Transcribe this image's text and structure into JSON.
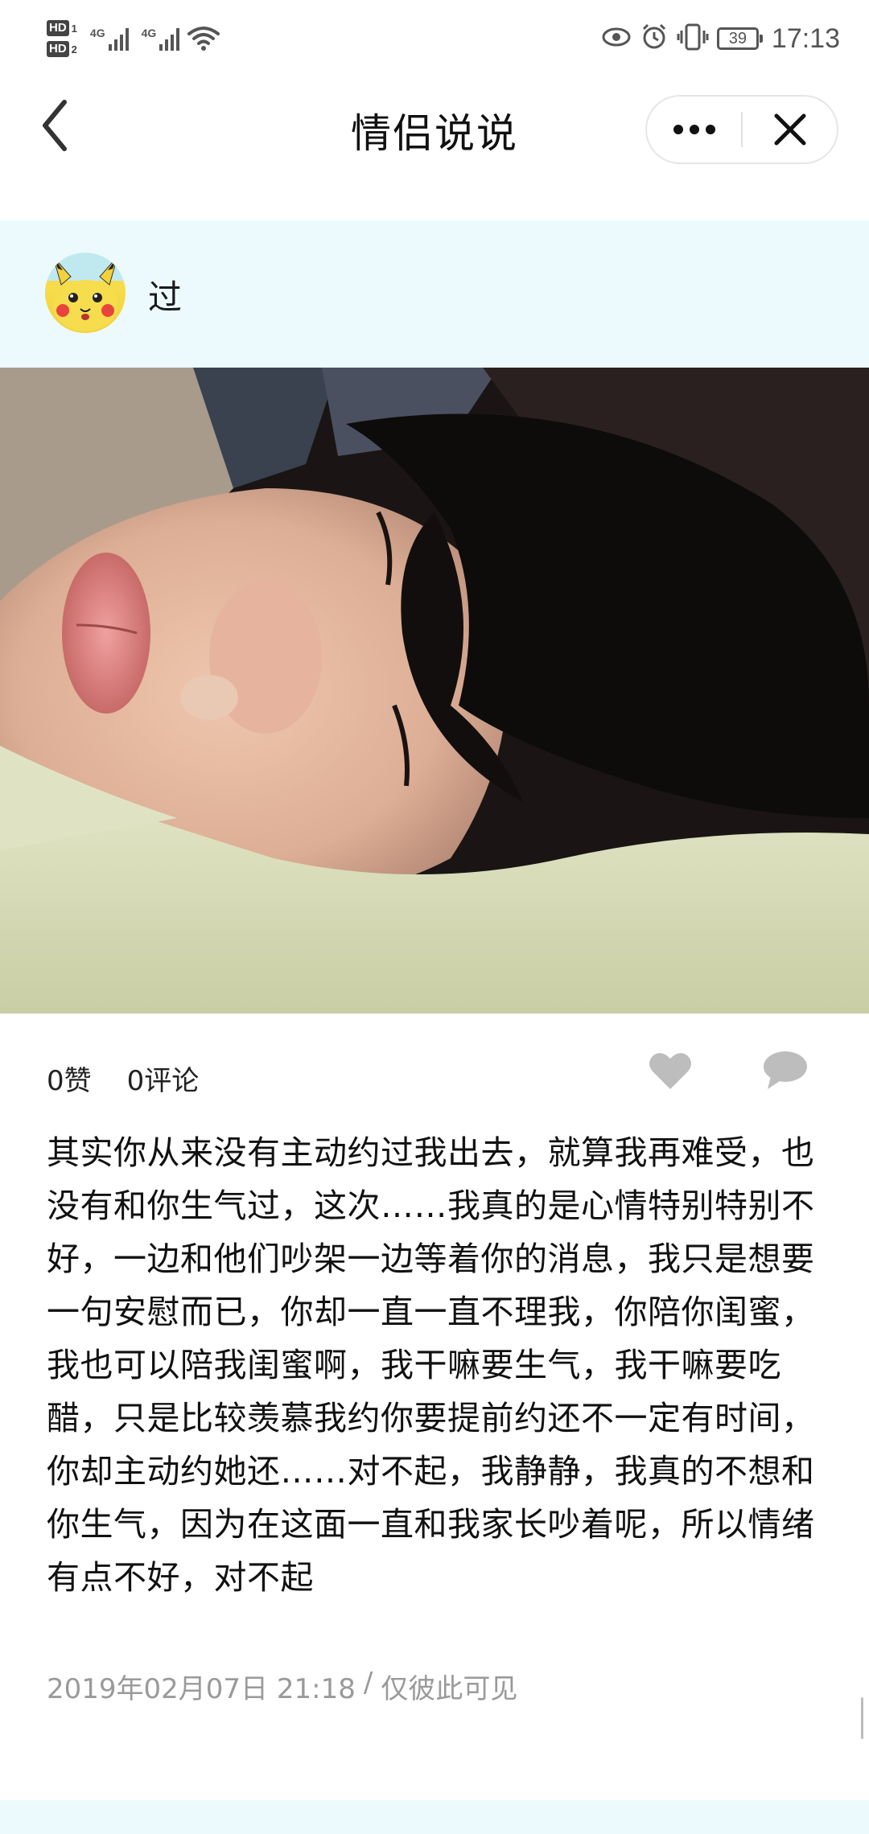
{
  "status_bar": {
    "sim1_badge": "HD",
    "sim1_num": "1",
    "sim2_badge": "HD",
    "sim2_num": "2",
    "network1": "4G",
    "network2": "4G",
    "battery": "39",
    "time": "17:13"
  },
  "title_bar": {
    "title": "情侣说说",
    "more_label": "•••",
    "close_label": "✕"
  },
  "post": {
    "username": "过",
    "likes": "0赞",
    "comments": "0评论",
    "text": "其实你从来没有主动约过我出去，就算我再难受，也没有和你生气过，这次……我真的是心情特别特别不好，一边和他们吵架一边等着你的消息，我只是想要一句安慰而已，你却一直一直不理我，你陪你闺蜜，我也可以陪我闺蜜啊，我干嘛要生气，我干嘛要吃醋，只是比较羡慕我约你要提前约还不一定有时间，你却主动约她还……对不起，我静静，我真的不想和你生气，因为在这面一直和我家长吵着呢，所以情绪有点不好，对不起",
    "timestamp": "2019年02月07日 21:18",
    "separator": "/",
    "visibility": "仅彼此可见"
  },
  "colors": {
    "header_bg": "#ecfafd",
    "icon_gray": "#bdbdbd",
    "meta_text": "#9a9a9a"
  }
}
